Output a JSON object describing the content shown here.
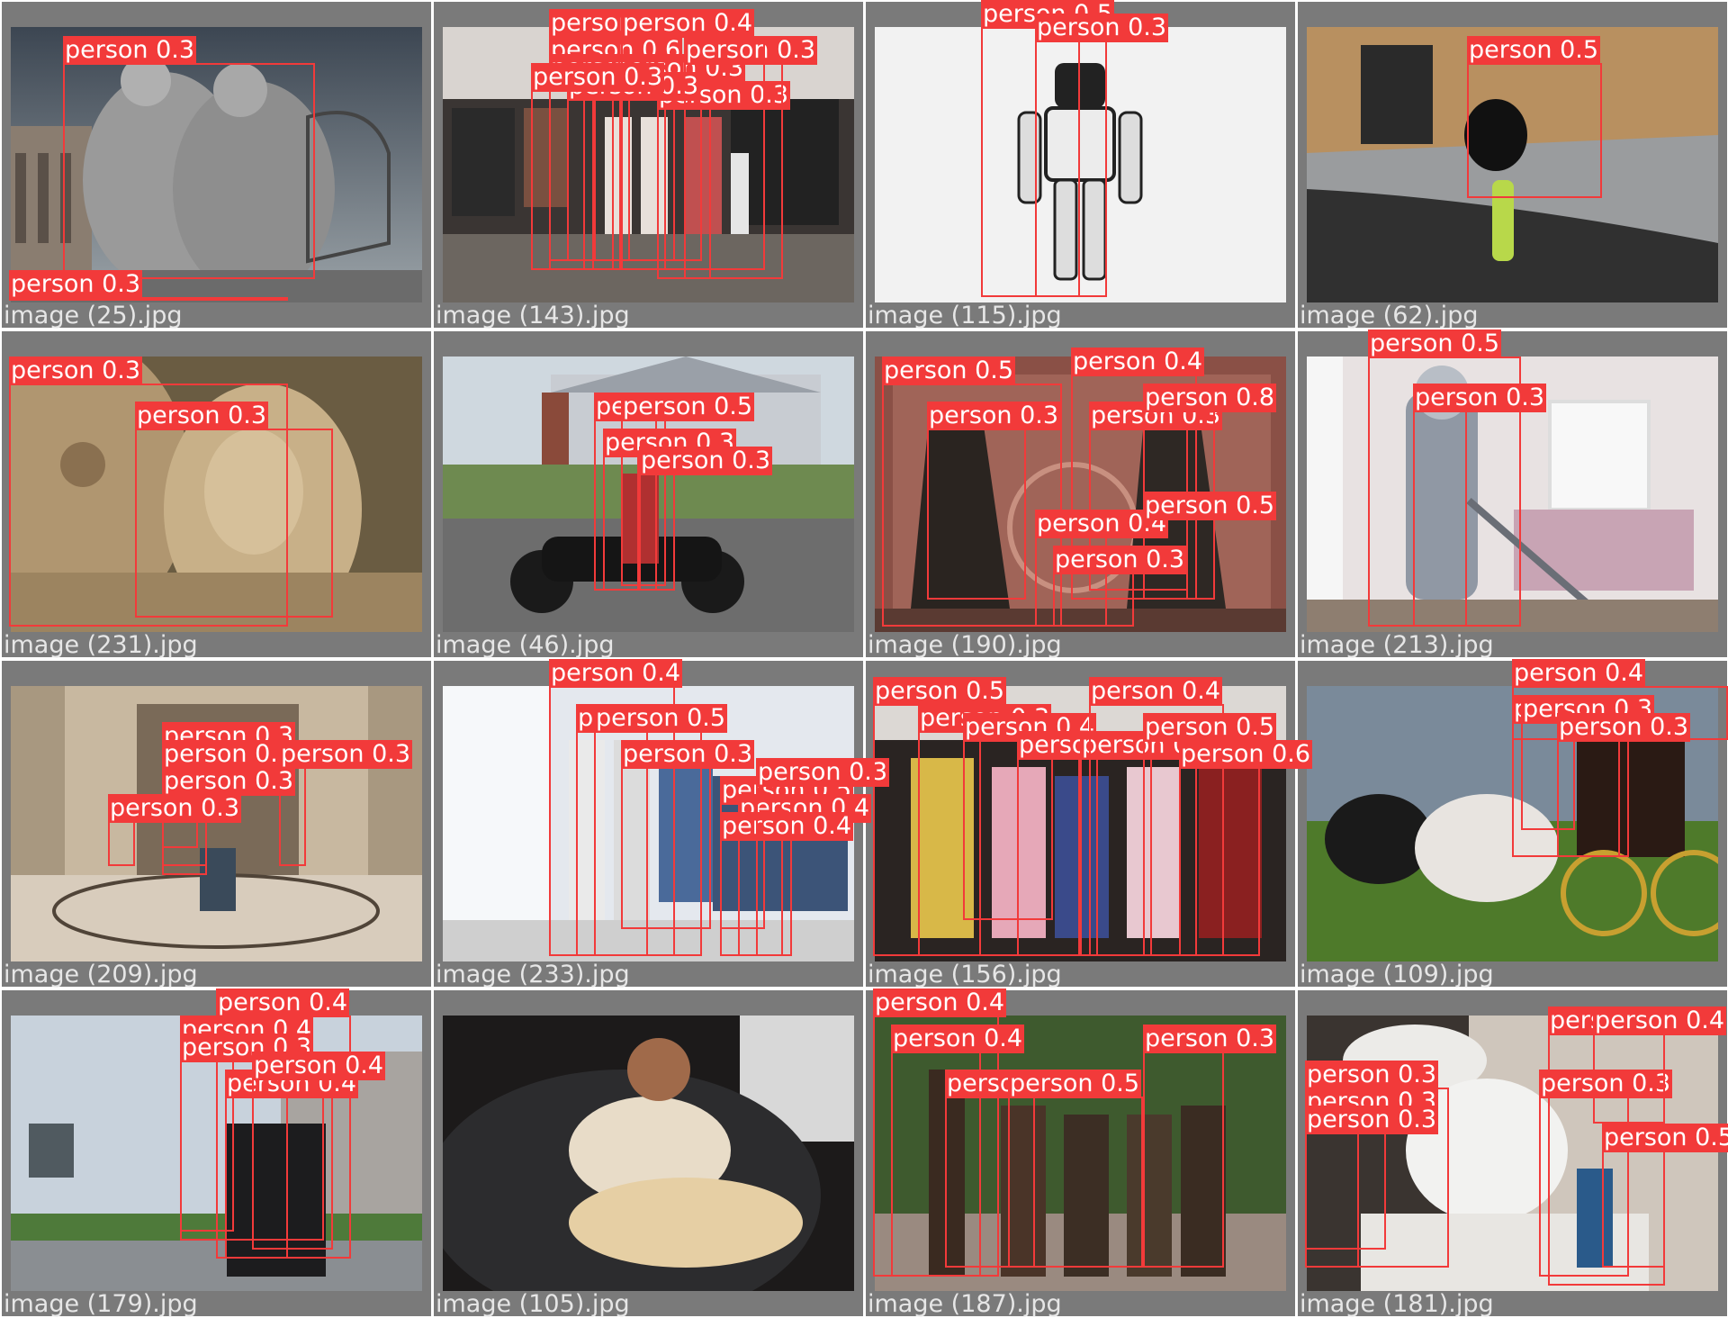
{
  "detection_label": "person",
  "box_color": "#f23a3a",
  "cells": [
    {
      "filename": "image (25).jpg",
      "scene": "wire sculpture of two figures on a bench",
      "scores": [
        "0.3",
        "0.3"
      ]
    },
    {
      "filename": "image (143).jpg",
      "scene": "clothing store with mannequins",
      "scores": [
        "0.4",
        "0.6",
        "0.3",
        "0.5",
        "0.3",
        "0.3",
        "0.3",
        "0.4",
        "0.3",
        "0.3"
      ]
    },
    {
      "filename": "image (115).jpg",
      "scene": "humanoid robot on white background",
      "scores": [
        "0.5",
        "0.3"
      ]
    },
    {
      "filename": "image (62).jpg",
      "scene": "person sitting by wall with bottle",
      "scores": [
        "0.5"
      ]
    },
    {
      "filename": "image (231).jpg",
      "scene": "stone carved faces",
      "scores": [
        "0.3",
        "0.3"
      ]
    },
    {
      "filename": "image (46).jpg",
      "scene": "motorcycle in front of house",
      "scores": [
        "0.4",
        "0.5",
        "0.3",
        "0.3"
      ]
    },
    {
      "filename": "image (190).jpg",
      "scene": "bronze statues in hall",
      "scores": [
        "0.5",
        "0.3",
        "0.4",
        "0.3",
        "0.8",
        "0.4",
        "0.3",
        "0.5"
      ]
    },
    {
      "filename": "image (213).jpg",
      "scene": "robot vacuuming a bedroom",
      "scores": [
        "0.5",
        "0.3"
      ]
    },
    {
      "filename": "image (209).jpg",
      "scene": "marble hall interior",
      "scores": [
        "0.3",
        "0.3",
        "0.3",
        "0.3",
        "0.3"
      ]
    },
    {
      "filename": "image (233).jpg",
      "scene": "fashion store with mannequins",
      "scores": [
        "0.4",
        "0.5",
        "0.5",
        "0.3",
        "0.5",
        "0.4",
        "0.4",
        "0.3"
      ]
    },
    {
      "filename": "image (156).jpg",
      "scene": "crowd of people indoors",
      "scores": [
        "0.5",
        "0.3",
        "0.4",
        "0.3",
        "0.3",
        "0.4",
        "0.5",
        "0.6"
      ]
    },
    {
      "filename": "image (109).jpg",
      "scene": "horse-drawn carriage",
      "scores": [
        "0.4",
        "0.5",
        "0.3",
        "0.3"
      ]
    },
    {
      "filename": "image (179).jpg",
      "scene": "waterfront with equestrian statue",
      "scores": [
        "0.4",
        "0.4",
        "0.3",
        "0.4",
        "0.4"
      ]
    },
    {
      "filename": "image (105).jpg",
      "scene": "woman resting with dog on couch",
      "scores": []
    },
    {
      "filename": "image (187).jpg",
      "scene": "bronze statues of people in park",
      "scores": [
        "0.4",
        "0.4",
        "0.3",
        "0.5",
        "0.3"
      ]
    },
    {
      "filename": "image (181).jpg",
      "scene": "gallery with white sculptures",
      "scores": [
        "0.3",
        "0.3",
        "0.3",
        "0.3",
        "0.3",
        "0.5",
        "0.4"
      ]
    }
  ]
}
